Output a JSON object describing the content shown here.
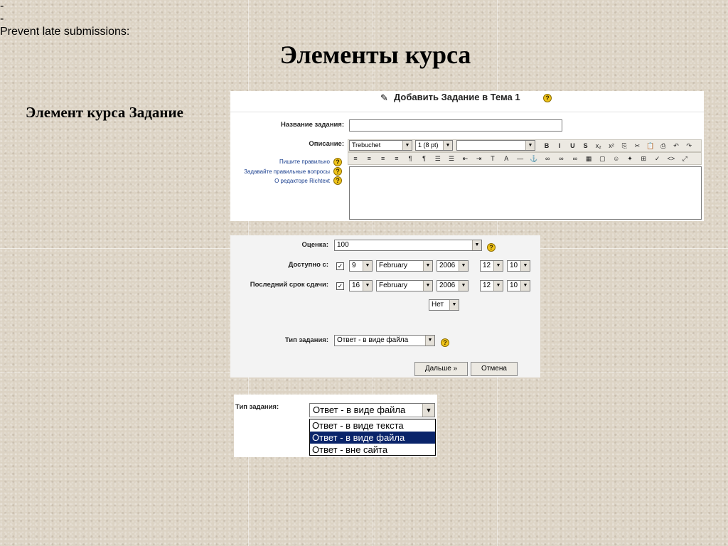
{
  "slide": {
    "title": "Элементы курса",
    "side_label": "Элемент курса Задание"
  },
  "assignment_form": {
    "header_title": "Добавить Задание в Тема 1",
    "name_label": "Название задания:",
    "name_value": "",
    "description_label": "Описание:",
    "links": [
      "Пишите правильно",
      "Задавайте правильные вопросы",
      "О редакторе Richtext"
    ],
    "font_family_value": "Trebuchet",
    "font_size_value": "1 (8 pt)",
    "style_value": "",
    "toolbar_row1": [
      "B",
      "I",
      "U",
      "S",
      "x₂",
      "x²",
      "⎘",
      "✂",
      "📋",
      "⎙",
      "↶",
      "↷"
    ],
    "toolbar_row2": [
      "≡",
      "≡",
      "≡",
      "≡",
      "¶",
      "¶",
      "☰",
      "☰",
      "⇤",
      "⇥",
      "T",
      "A",
      "—",
      "⚓",
      "∞",
      "∞",
      "∞",
      "▦",
      "▢",
      "☺",
      "✦",
      "⊞",
      "✓",
      "<>",
      "⤢"
    ]
  },
  "settings": {
    "grade_label": "Оценка:",
    "grade_value": "100",
    "available_label": "Доступно с:",
    "available": {
      "checked": true,
      "day": "9",
      "month": "February",
      "year": "2006",
      "hour": "12",
      "minute": "10"
    },
    "due_label": "Последний срок сдачи:",
    "due": {
      "checked": true,
      "day": "16",
      "month": "February",
      "year": "2006",
      "hour": "12",
      "minute": "10"
    },
    "dash": "-",
    "prevent_late_label": "Prevent late submissions:",
    "prevent_late_value": "Нет",
    "type_label": "Тип задания:",
    "type_value": "Ответ - в виде файла",
    "next_button": "Дальше »",
    "cancel_button": "Отмена"
  },
  "type_dropdown": {
    "label": "Тип задания:",
    "selected_value": "Ответ - в виде файла",
    "options": [
      "Ответ - в виде текста",
      "Ответ - в виде файла",
      "Ответ - вне сайта"
    ],
    "highlighted_index": 1
  },
  "colors": {
    "background": "#dcd3c4",
    "link": "#1a3f8f",
    "highlight": "#0a246a",
    "help_icon": "#f0c419"
  }
}
